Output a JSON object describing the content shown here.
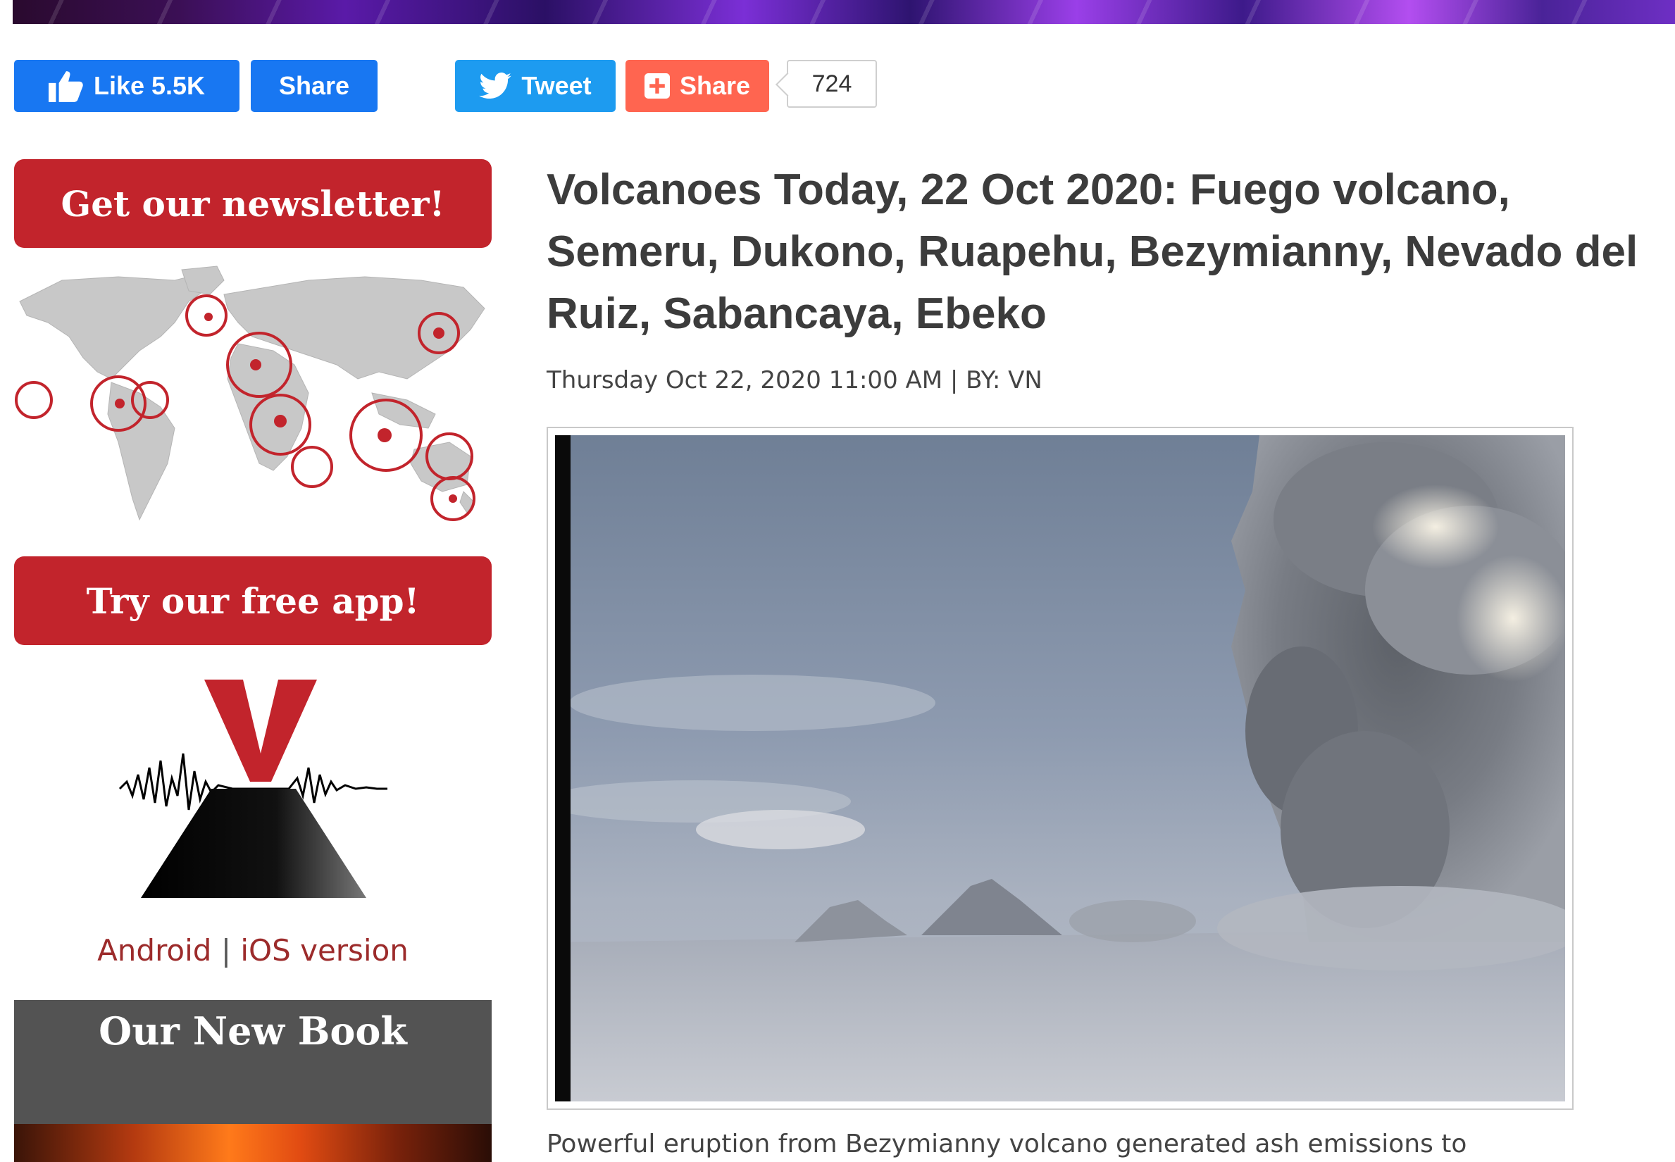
{
  "social": {
    "fb_like_label": "Like 5.5K",
    "fb_share_label": "Share",
    "tweet_label": "Tweet",
    "addthis_share_label": "Share",
    "share_count": "724"
  },
  "sidebar": {
    "newsletter_label": "Get our newsletter!",
    "app_label": "Try our free app!",
    "app_android": "Android",
    "app_separator": "|",
    "app_ios": "iOS version",
    "book_title": "Our New Book"
  },
  "article": {
    "title": "Volcanoes Today, 22 Oct 2020: Fuego volcano, Semeru, Dukono, Ruapehu, Bezymianny, Nevado del Ruiz, Sabancaya, Ebeko",
    "meta": "Thursday Oct 22, 2020 11:00 AM | BY: VN",
    "caption": "Powerful eruption from Bezymianny volcano generated ash emissions to"
  },
  "colors": {
    "facebook": "#1877f2",
    "twitter": "#1d9bf0",
    "addthis": "#ff6550",
    "brand_red": "#c2242c",
    "title_text": "#3c3c3c"
  },
  "icons": [
    "thumbs-up-icon",
    "twitter-bird-icon",
    "plus-square-icon"
  ]
}
